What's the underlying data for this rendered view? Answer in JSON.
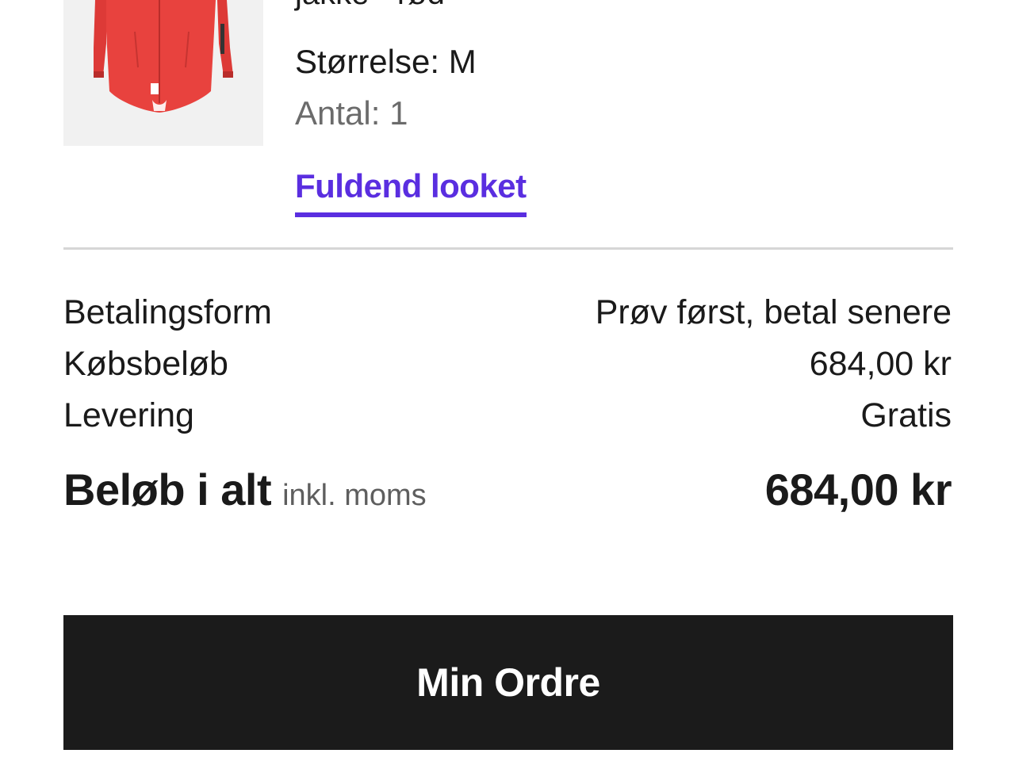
{
  "product": {
    "name_partial": "jakke - rød",
    "size_text": "Størrelse: M",
    "quantity_text": "Antal: 1",
    "complete_look_link": "Fuldend looket",
    "jacket_color": "#e8423e"
  },
  "summary": {
    "rows": [
      {
        "label": "Betalingsform",
        "value": "Prøv først, betal senere"
      },
      {
        "label": "Købsbeløb",
        "value": "684,00 kr"
      },
      {
        "label": "Levering",
        "value": "Gratis"
      }
    ],
    "total_label": "Beløb i alt",
    "total_note": "inkl. moms",
    "total_value": "684,00 kr"
  },
  "actions": {
    "my_order_label": "Min Ordre"
  },
  "colors": {
    "link": "#5a2ee0",
    "button_bg": "#1b1b1b",
    "divider": "#d6d6d6"
  }
}
